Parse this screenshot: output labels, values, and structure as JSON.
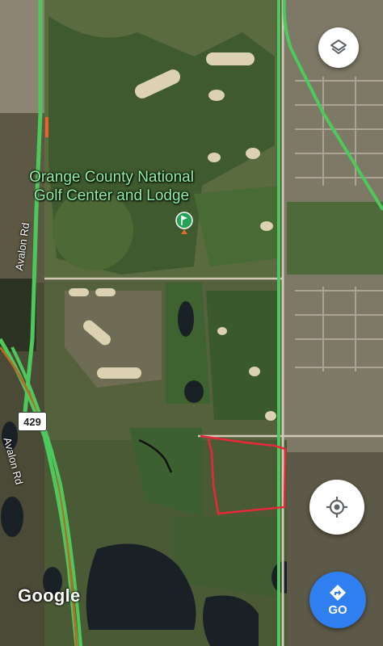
{
  "map": {
    "place_name_line1": "Orange County National",
    "place_name_line2": "Golf Center and Lodge",
    "place_icon": "golf-flag-icon",
    "roads": {
      "avalon_upper": "Avalon Rd",
      "avalon_lower": "Avalon Rd",
      "route_shield": "429"
    },
    "attribution": "Google",
    "colors": {
      "highway_green": "#4cc95a",
      "boundary_red": "#e8283a",
      "label_green": "#8ff0a4",
      "go_blue": "#2f7ff0"
    }
  },
  "controls": {
    "layers_icon": "layers-icon",
    "locate_icon": "my-location-icon",
    "go_icon": "directions-icon",
    "go_label": "GO"
  }
}
